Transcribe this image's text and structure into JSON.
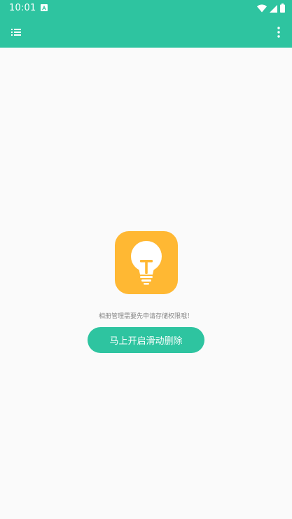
{
  "status_bar": {
    "time": "10:01",
    "icons": [
      "notification-a-icon",
      "wifi-icon",
      "signal-icon",
      "battery-icon"
    ]
  },
  "app_bar": {
    "icons": [
      "list-menu-icon",
      "more-vert-icon"
    ],
    "color": "#2ec4a0"
  },
  "main": {
    "icon": "lightbulb-icon",
    "icon_color": "#ffb833",
    "message": "相册管理需要先申请存储权限哦！",
    "button_label": "马上开启滑动删除"
  }
}
